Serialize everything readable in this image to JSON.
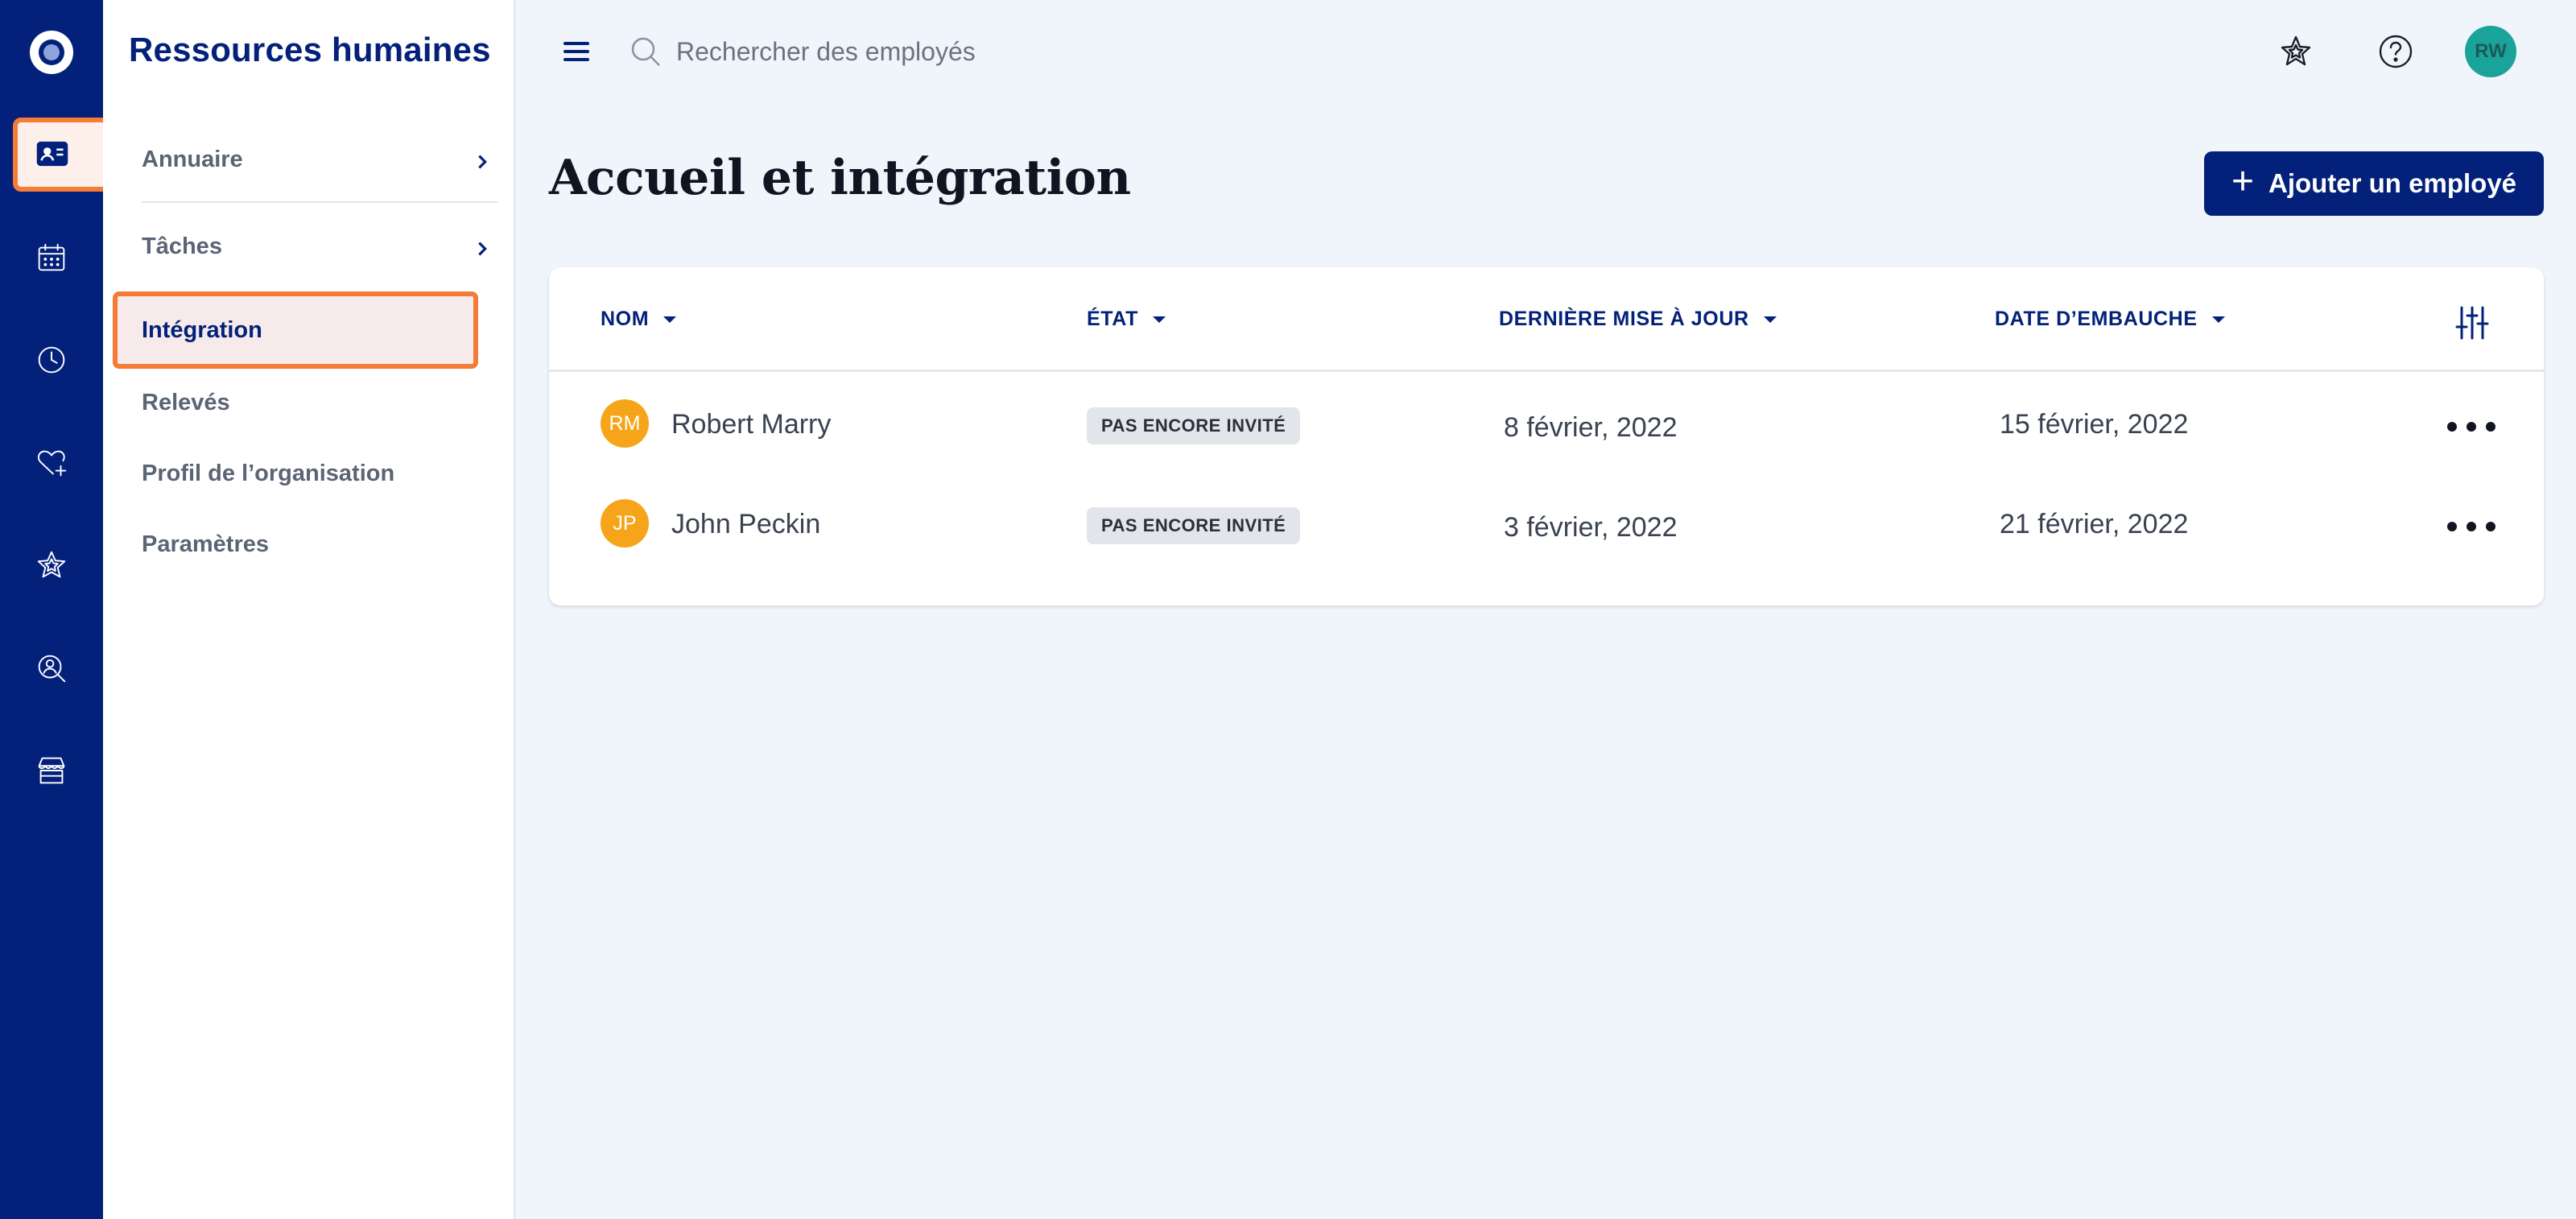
{
  "rail": {
    "items": [
      {
        "name": "logo-icon"
      },
      {
        "name": "hr-directory-icon"
      },
      {
        "name": "calendar-icon"
      },
      {
        "name": "clock-icon"
      },
      {
        "name": "heart-plus-icon"
      },
      {
        "name": "star-icon"
      },
      {
        "name": "person-search-icon"
      },
      {
        "name": "store-icon"
      }
    ]
  },
  "sidebar": {
    "title": "Ressources humaines",
    "items": [
      {
        "label": "Annuaire",
        "has_chevron": true
      },
      {
        "label": "Tâches",
        "has_chevron": true
      },
      {
        "label": "Intégration",
        "active": true
      },
      {
        "label": "Relevés"
      },
      {
        "label": "Profil de l’organisation"
      },
      {
        "label": "Paramètres"
      }
    ]
  },
  "topbar": {
    "search_placeholder": "Rechercher des employés",
    "avatar_initials": "RW"
  },
  "page": {
    "title": "Accueil et intégration",
    "add_button_label": "Ajouter un employé"
  },
  "table": {
    "headers": [
      "NOM",
      "ÉTAT",
      "DERNIÈRE MISE À JOUR",
      "DATE D’EMBAUCHE"
    ],
    "rows": [
      {
        "initials": "RM",
        "name": "Robert Marry",
        "status": "PAS ENCORE INVITÉ",
        "updated": "8 février, 2022",
        "hire_date": "15 février, 2022"
      },
      {
        "initials": "JP",
        "name": "John Peckin",
        "status": "PAS ENCORE INVITÉ",
        "updated": "3 février, 2022",
        "hire_date": "21 février, 2022"
      }
    ]
  },
  "colors": {
    "rail_bg": "#03217a",
    "accent": "#03217a",
    "highlight": "#f47c36",
    "avatar_row": "#f6a51a",
    "avatar_user": "#1aa39b"
  }
}
